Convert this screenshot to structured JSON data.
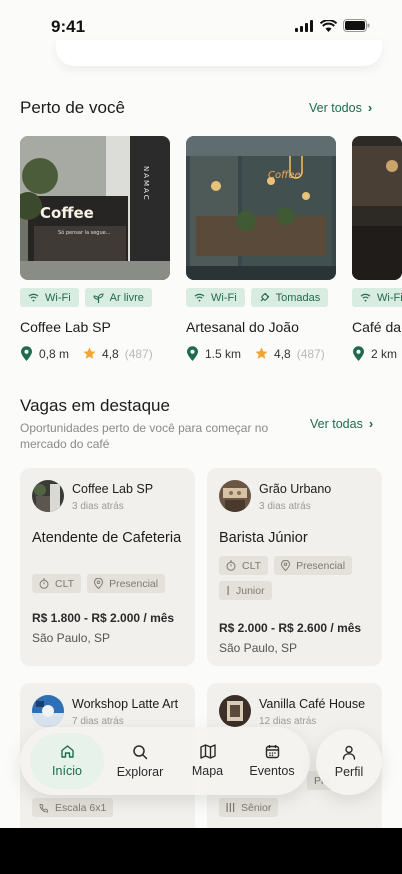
{
  "status": {
    "time": "9:41"
  },
  "nearby": {
    "title": "Perto de você",
    "see_all": "Ver todos",
    "places": [
      {
        "name": "Coffee Lab SP",
        "tags": [
          "Wi-Fi",
          "Ar livre"
        ],
        "tag_icons": [
          "wifi-icon",
          "plant-icon"
        ],
        "distance": "0,8 m",
        "rating": "4,8",
        "reviews": "(487)",
        "photo_sign": "Coffee",
        "photo_sub": "Só pensar la segue...",
        "photo_side": "NAMAC"
      },
      {
        "name": "Artesanal do João",
        "tags": [
          "Wi-Fi",
          "Tomadas"
        ],
        "tag_icons": [
          "wifi-icon",
          "plug-icon"
        ],
        "distance": "1.5 km",
        "rating": "4,8",
        "reviews": "(487)",
        "photo_sign": "Coffee"
      },
      {
        "name": "Café da",
        "tags": [
          "Wi-Fi"
        ],
        "tag_icons": [
          "wifi-icon"
        ],
        "distance": "2 km"
      }
    ]
  },
  "jobs": {
    "title": "Vagas em destaque",
    "subtitle": "Oportunidades perto de você para começar no mercado do café",
    "see_all": "Ver todas",
    "items": [
      {
        "company": "Coffee Lab SP",
        "ago": "3 dias atrás",
        "role": "Atendente de Cafeteria",
        "chips": [
          "CLT",
          "Presencial"
        ],
        "salary": "R$ 1.800 - R$ 2.000 / mês",
        "city": "São Paulo, SP"
      },
      {
        "company": "Grão Urbano",
        "ago": "3 dias atrás",
        "role": "Barista Júnior",
        "chips": [
          "CLT",
          "Presencial",
          "Junior"
        ],
        "salary": "R$ 2.000 - R$ 2.600 / mês",
        "city": "São Paulo, SP"
      },
      {
        "company": "Workshop Latte Art",
        "ago": "7 dias atrás",
        "chips": [
          "Escala 6x1"
        ]
      },
      {
        "company": "Vanilla Café House",
        "ago": "12 dias atrás",
        "chips": [
          "Pre",
          "Sênior"
        ]
      }
    ]
  },
  "nav": {
    "items": [
      {
        "label": "Início",
        "icon": "home-icon",
        "active": true
      },
      {
        "label": "Explorar",
        "icon": "search-icon"
      },
      {
        "label": "Mapa",
        "icon": "map-icon"
      },
      {
        "label": "Eventos",
        "icon": "calendar-icon"
      }
    ],
    "profile": {
      "label": "Perfil",
      "icon": "user-icon"
    }
  },
  "colors": {
    "accent": "#1f6b4c",
    "tag_bg": "#d9ece1",
    "card_bg": "#f1f0ec",
    "star": "#f2a532"
  }
}
